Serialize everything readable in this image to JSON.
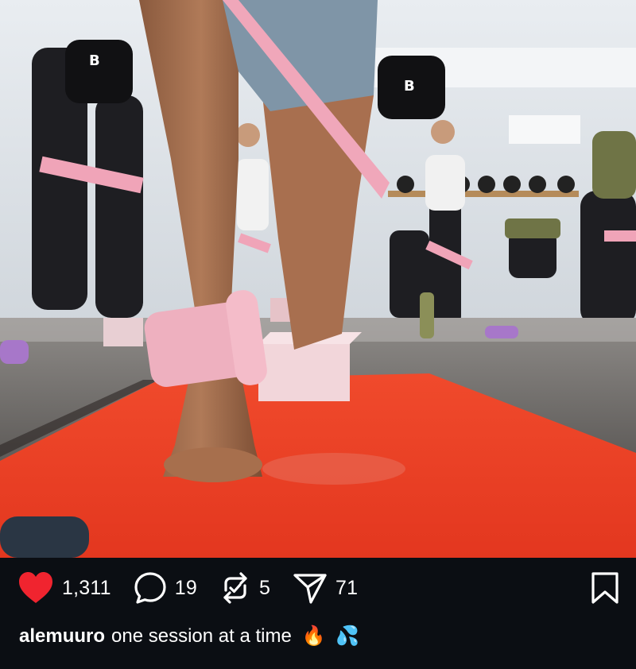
{
  "post": {
    "media_description": "photo",
    "likes": "1,311",
    "comments": "19",
    "reposts": "5",
    "shares": "71",
    "liked": true,
    "colors": {
      "like": "#f0242f",
      "background": "#0b0e13",
      "text": "#ffffff"
    }
  },
  "caption": {
    "username": "alemuuro",
    "text": "one session at a time",
    "emoji_1": "🔥",
    "emoji_2": "💦"
  },
  "icons": {
    "like": "heart-icon",
    "comment": "comment-bubble-icon",
    "repost": "repost-icon",
    "share": "paper-plane-icon",
    "save": "bookmark-icon"
  }
}
